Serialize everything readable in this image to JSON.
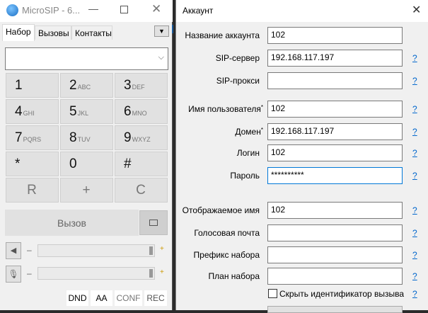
{
  "left": {
    "title": "MicroSIP - 6...",
    "tabs": [
      "Набор",
      "Вызовы",
      "Контакты"
    ],
    "dial_value": "",
    "keys": [
      [
        "1",
        ""
      ],
      [
        "2",
        "ABC"
      ],
      [
        "3",
        "DEF"
      ],
      [
        "4",
        "GHI"
      ],
      [
        "5",
        "JKL"
      ],
      [
        "6",
        "MNO"
      ],
      [
        "7",
        "PQRS"
      ],
      [
        "8",
        "TUV"
      ],
      [
        "9",
        "WXYZ"
      ],
      [
        "*",
        ""
      ],
      [
        "0",
        ""
      ],
      [
        "#",
        ""
      ],
      [
        "R",
        ""
      ],
      [
        "+",
        ""
      ],
      [
        "C",
        ""
      ]
    ],
    "call_label": "Вызов",
    "minus": "–",
    "plus": "+",
    "volume_speaker": 0.98,
    "volume_mic": 0.98,
    "bottom_buttons": [
      "DND",
      "AA",
      "CONF",
      "REC"
    ]
  },
  "dialog": {
    "title": "Аккаунт",
    "help": "?",
    "required_mark": "*",
    "fields": [
      {
        "label": "Название аккаунта",
        "value": "102"
      },
      {
        "label": "SIP-сервер",
        "value": "192.168.117.197"
      },
      {
        "label": "SIP-прокси",
        "value": ""
      },
      {
        "label": "Имя пользователя",
        "value": "102"
      },
      {
        "label": "Домен",
        "value": "192.168.117.197"
      },
      {
        "label": "Логин",
        "value": "102"
      },
      {
        "label": "Пароль",
        "value": "**********"
      },
      {
        "label": "Отображаемое имя",
        "value": "102"
      },
      {
        "label": "Голосовая почта",
        "value": ""
      },
      {
        "label": "Префикс набора",
        "value": ""
      },
      {
        "label": "План набора",
        "value": ""
      }
    ],
    "checkbox_label": "Скрыть идентификатор вызываю щ"
  }
}
